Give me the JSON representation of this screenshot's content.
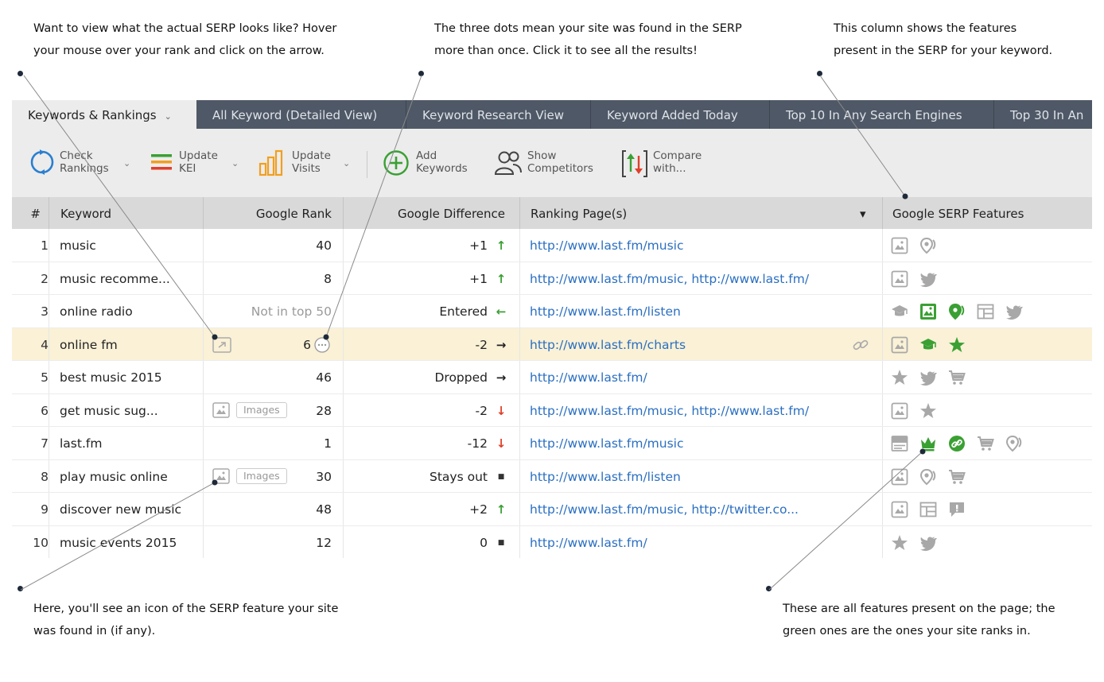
{
  "callouts": {
    "top_left": [
      "Want to view what the actual SERP looks like? Hover",
      "your mouse over your rank and click on the arrow."
    ],
    "top_middle": [
      "The three dots mean your site was found in the SERP",
      "more than once. Click it to see all the results!"
    ],
    "top_right": [
      "This column shows the features",
      "present in the SERP for your keyword."
    ],
    "bottom_left": [
      "Here, you'll see an icon of the SERP feature your site",
      "was found in (if any)."
    ],
    "bottom_right": [
      "These are all features present on the page; the",
      "green ones are the ones your site ranks in."
    ]
  },
  "tabs": [
    {
      "label": "Keywords & Rankings",
      "active": true
    },
    {
      "label": "All Keyword (Detailed View)"
    },
    {
      "label": "Keyword Research View"
    },
    {
      "label": "Keyword Added Today"
    },
    {
      "label": "Top 10 In Any Search Engines"
    },
    {
      "label": "Top 30 In An"
    }
  ],
  "toolbar": {
    "check": [
      "Check",
      "Rankings"
    ],
    "kei": [
      "Update",
      "KEI"
    ],
    "visits": [
      "Update",
      "Visits"
    ],
    "add": [
      "Add",
      "Keywords"
    ],
    "competitors": [
      "Show",
      "Competitors"
    ],
    "compare": [
      "Compare",
      "with..."
    ]
  },
  "columns": {
    "num": "#",
    "keyword": "Keyword",
    "rank": "Google Rank",
    "diff": "Google Difference",
    "pages": "Ranking Page(s)",
    "features": "Google SERP Features"
  },
  "colors": {
    "green": "#3aa033",
    "red": "#e0402a",
    "grey_icon": "#a8a8a8",
    "link": "#2a6fc1",
    "highlight": "#faf1d6"
  },
  "rows": [
    {
      "num": "1",
      "keyword": "music",
      "rank": "40",
      "diff": "+1",
      "dir": "up",
      "page": "http://www.last.fm/music",
      "features": [
        [
          "image",
          "grey"
        ],
        [
          "local",
          "grey"
        ]
      ]
    },
    {
      "num": "2",
      "keyword": "music recomme...",
      "rank": "8",
      "diff": "+1",
      "dir": "up",
      "page": "http://www.last.fm/music, http://www.last.fm/",
      "features": [
        [
          "image",
          "grey"
        ],
        [
          "twitter",
          "grey"
        ]
      ]
    },
    {
      "num": "3",
      "keyword": "online radio",
      "rank": "Not in top 50",
      "rank_muted": true,
      "diff": "Entered",
      "dir": "left",
      "page": "http://www.last.fm/listen",
      "features": [
        [
          "knowledge",
          "grey"
        ],
        [
          "image",
          "green"
        ],
        [
          "local",
          "green"
        ],
        [
          "table",
          "grey"
        ],
        [
          "twitter",
          "grey"
        ]
      ]
    },
    {
      "num": "4",
      "keyword": "online fm",
      "rank": "6",
      "highlight": true,
      "serp_icon": true,
      "dots": true,
      "link_icon": true,
      "diff": "-2",
      "dir": "right",
      "page": "http://www.last.fm/charts",
      "features": [
        [
          "image",
          "grey"
        ],
        [
          "knowledge",
          "green"
        ],
        [
          "star",
          "green"
        ]
      ]
    },
    {
      "num": "5",
      "keyword": "best music 2015",
      "rank": "46",
      "diff": "Dropped",
      "dir": "right",
      "page": "http://www.last.fm/",
      "features": [
        [
          "star",
          "grey"
        ],
        [
          "twitter",
          "grey"
        ],
        [
          "cart",
          "grey"
        ]
      ]
    },
    {
      "num": "6",
      "keyword": "get music sug...",
      "rank": "28",
      "images_badge": "Images",
      "diff": "-2",
      "dir": "down",
      "page": "http://www.last.fm/music, http://www.last.fm/",
      "features": [
        [
          "image",
          "grey"
        ],
        [
          "star",
          "grey"
        ]
      ]
    },
    {
      "num": "7",
      "keyword": "last.fm",
      "rank": "1",
      "diff": "-12",
      "dir": "down",
      "page": "http://www.last.fm/music",
      "features": [
        [
          "ad",
          "grey"
        ],
        [
          "crown",
          "green"
        ],
        [
          "link",
          "green"
        ],
        [
          "cart",
          "grey"
        ],
        [
          "local",
          "grey"
        ]
      ]
    },
    {
      "num": "8",
      "keyword": "play music online",
      "rank": "30",
      "images_badge": "Images",
      "diff": "Stays out",
      "dir": "none",
      "page": "http://www.last.fm/listen",
      "features": [
        [
          "image",
          "grey"
        ],
        [
          "local",
          "grey"
        ],
        [
          "cart",
          "grey"
        ]
      ]
    },
    {
      "num": "9",
      "keyword": "discover new music",
      "rank": "48",
      "diff": "+2",
      "dir": "up",
      "page": "http://www.last.fm/music, http://twitter.co...",
      "features": [
        [
          "image",
          "grey"
        ],
        [
          "table",
          "grey"
        ],
        [
          "review",
          "grey"
        ]
      ]
    },
    {
      "num": "10",
      "keyword": "music events 2015",
      "rank": "12",
      "diff": "0",
      "dir": "none",
      "page": "http://www.last.fm/",
      "features": [
        [
          "star",
          "grey"
        ],
        [
          "twitter",
          "grey"
        ]
      ]
    }
  ]
}
